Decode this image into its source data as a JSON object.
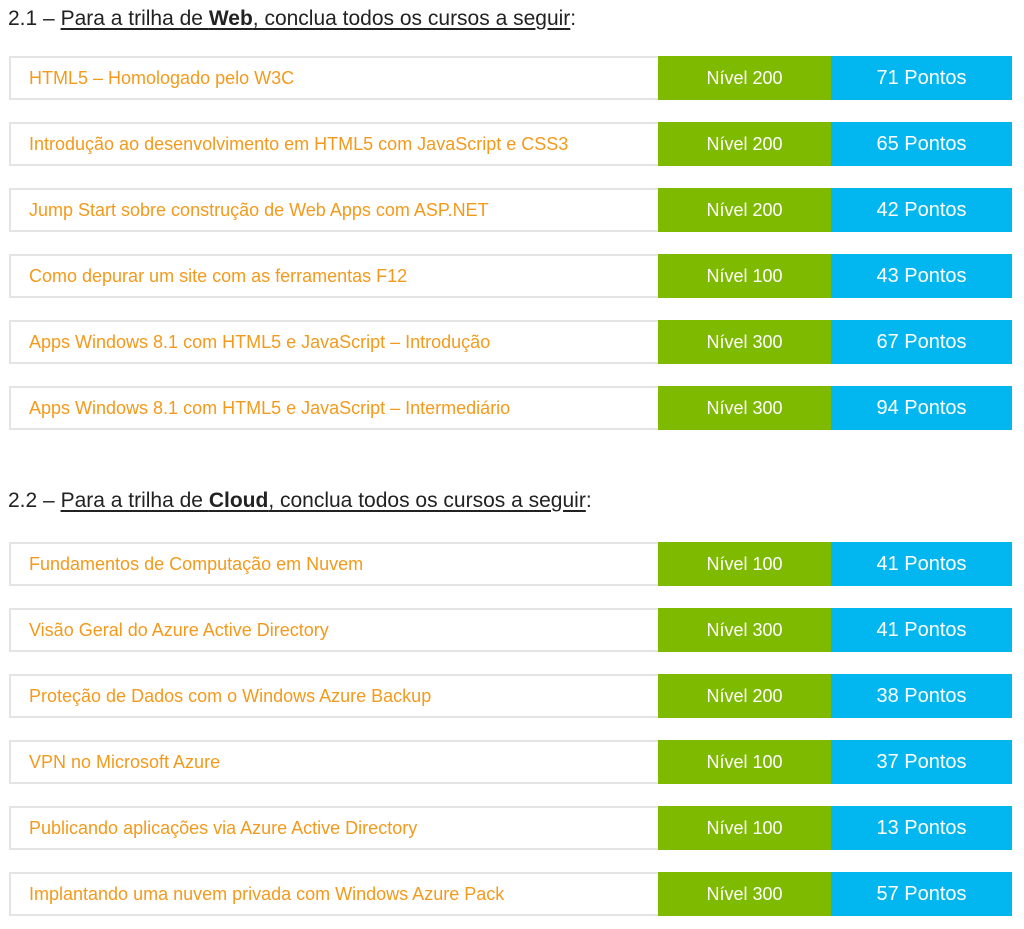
{
  "sections": [
    {
      "number": "2.1 –",
      "heading_pre": "Para a trilha de",
      "heading_track": "Web",
      "heading_post": ", conclua todos os cursos a seguir",
      "heading_colon": ":",
      "courses": [
        {
          "title": "HTML5 – Homologado pelo W3C",
          "level": "Nível 200",
          "points": "71 Pontos"
        },
        {
          "title": "Introdução ao desenvolvimento em HTML5 com JavaScript e CSS3",
          "level": "Nível 200",
          "points": "65 Pontos"
        },
        {
          "title": "Jump Start sobre construção de Web Apps com ASP.NET",
          "level": "Nível 200",
          "points": "42 Pontos"
        },
        {
          "title": "Como depurar um site com as ferramentas F12",
          "level": "Nível 100",
          "points": "43 Pontos"
        },
        {
          "title": "Apps Windows 8.1 com HTML5 e JavaScript – Introdução",
          "level": "Nível 300",
          "points": "67 Pontos"
        },
        {
          "title": "Apps Windows 8.1 com HTML5 e JavaScript – Intermediário",
          "level": "Nível 300",
          "points": "94 Pontos"
        }
      ]
    },
    {
      "number": "2.2 –",
      "heading_pre": "Para a trilha de",
      "heading_track": "Cloud",
      "heading_post": ", conclua todos os cursos a seguir",
      "heading_colon": ":",
      "courses": [
        {
          "title": "Fundamentos de Computação em Nuvem",
          "level": "Nível 100",
          "points": "41 Pontos"
        },
        {
          "title": "Visão Geral do Azure Active Directory",
          "level": "Nível 300",
          "points": "41 Pontos"
        },
        {
          "title": "Proteção de Dados com o Windows Azure Backup",
          "level": "Nível 200",
          "points": "38 Pontos"
        },
        {
          "title": "VPN no Microsoft Azure",
          "level": "Nível 100",
          "points": "37 Pontos"
        },
        {
          "title": "Publicando aplicações via Azure Active Directory",
          "level": "Nível 100",
          "points": "13 Pontos"
        },
        {
          "title": "Implantando uma nuvem privada com Windows Azure Pack",
          "level": "Nível 300",
          "points": "57 Pontos"
        }
      ]
    }
  ],
  "colors": {
    "title_orange": "#f39a1c",
    "level_green": "#7eba00",
    "points_blue": "#02b7ef",
    "row_border": "#e4e4e4"
  }
}
